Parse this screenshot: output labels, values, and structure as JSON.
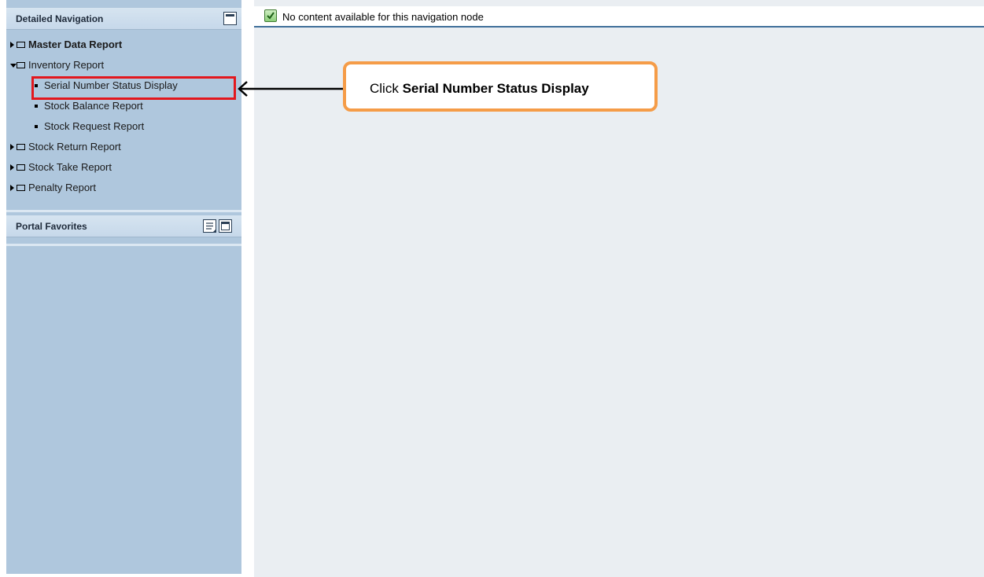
{
  "left_nav": {
    "detailed_navigation": {
      "title": "Detailed Navigation",
      "items": [
        {
          "label": "Master Data Report",
          "state": "collapsed",
          "bold": true
        },
        {
          "label": "Inventory Report",
          "state": "expanded",
          "bold": false,
          "children": [
            {
              "label": "Serial Number Status Display",
              "highlighted": true
            },
            {
              "label": "Stock Balance Report"
            },
            {
              "label": "Stock Request Report"
            }
          ]
        },
        {
          "label": "Stock Return Report",
          "state": "collapsed",
          "bold": false
        },
        {
          "label": "Stock Take Report",
          "state": "collapsed",
          "bold": false
        },
        {
          "label": "Penalty Report",
          "state": "collapsed",
          "bold": false
        }
      ]
    },
    "portal_favorites": {
      "title": "Portal Favorites"
    }
  },
  "content": {
    "message": "No content available for this navigation node",
    "message_icon": "checkmark-icon"
  },
  "annotation": {
    "callout_prefix": "Click",
    "callout_target": "Serial Number Status Display",
    "highlight_color": "#e3171d",
    "callout_border_color": "#f59c48"
  },
  "colors": {
    "panel_bg": "#afc7dd",
    "content_bg": "#eaeef2"
  }
}
